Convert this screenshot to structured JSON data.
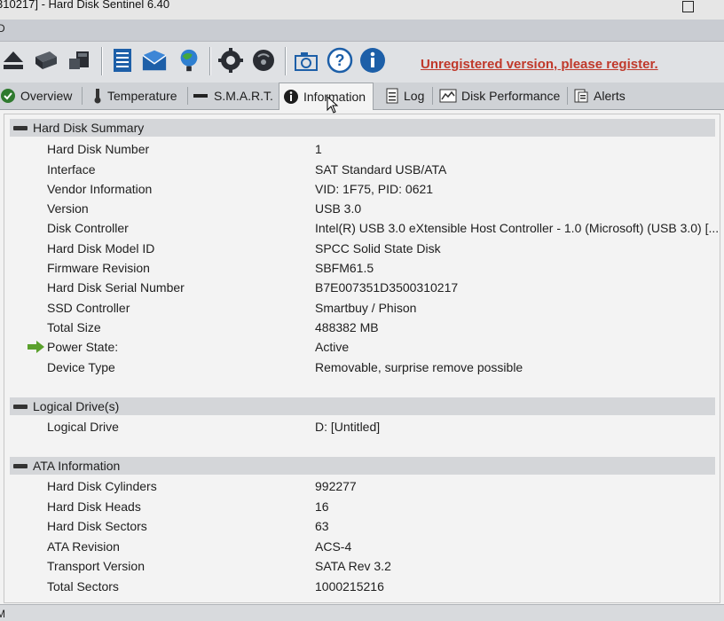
{
  "window": {
    "title": "310217] - Hard Disk Sentinel 6.40"
  },
  "menu": {
    "first_item": "D"
  },
  "toolbar": {
    "icons": [
      "eject-icon",
      "disk-icon",
      "disk-transfer-icon",
      "report-icon",
      "mail-icon",
      "network-icon",
      "settings-icon",
      "tray-icon",
      "camera-icon",
      "help-icon",
      "info-icon"
    ],
    "register_text": "Unregistered version, please register."
  },
  "tabs": [
    {
      "label": "Overview"
    },
    {
      "label": "Temperature"
    },
    {
      "label": "S.M.A.R.T."
    },
    {
      "label": "Information"
    },
    {
      "label": "Log"
    },
    {
      "label": "Disk Performance"
    },
    {
      "label": "Alerts"
    }
  ],
  "sections": {
    "summary": {
      "title": "Hard Disk Summary",
      "rows": [
        {
          "label": "Hard Disk Number",
          "value": "1"
        },
        {
          "label": "Interface",
          "value": "SAT Standard USB/ATA"
        },
        {
          "label": "Vendor Information",
          "value": "VID: 1F75, PID: 0621"
        },
        {
          "label": "Version",
          "value": "USB 3.0"
        },
        {
          "label": "Disk Controller",
          "value": "Intel(R) USB 3.0 eXtensible Host Controller - 1.0 (Microsoft) (USB 3.0) [..."
        },
        {
          "label": "Hard Disk Model ID",
          "value": "SPCC Solid State Disk"
        },
        {
          "label": "Firmware Revision",
          "value": "SBFM61.5"
        },
        {
          "label": "Hard Disk Serial Number",
          "value": "B7E007351D3500310217"
        },
        {
          "label": "SSD Controller",
          "value": "Smartbuy / Phison"
        },
        {
          "label": "Total Size",
          "value": "488382 MB"
        },
        {
          "label": "Power State:",
          "value": "Active"
        },
        {
          "label": "Device Type",
          "value": "Removable, surprise remove possible"
        }
      ]
    },
    "logical": {
      "title": "Logical Drive(s)",
      "rows": [
        {
          "label": "Logical Drive",
          "value": "D: [Untitled]"
        }
      ]
    },
    "ata": {
      "title": "ATA Information",
      "rows": [
        {
          "label": "Hard Disk Cylinders",
          "value": "992277"
        },
        {
          "label": "Hard Disk Heads",
          "value": "16"
        },
        {
          "label": "Hard Disk Sectors",
          "value": "63"
        },
        {
          "label": "ATA Revision",
          "value": "ACS-4"
        },
        {
          "label": "Transport Version",
          "value": "SATA Rev 3.2"
        },
        {
          "label": "Total Sectors",
          "value": "1000215216"
        }
      ]
    }
  },
  "statusbar": {
    "text": "M"
  }
}
